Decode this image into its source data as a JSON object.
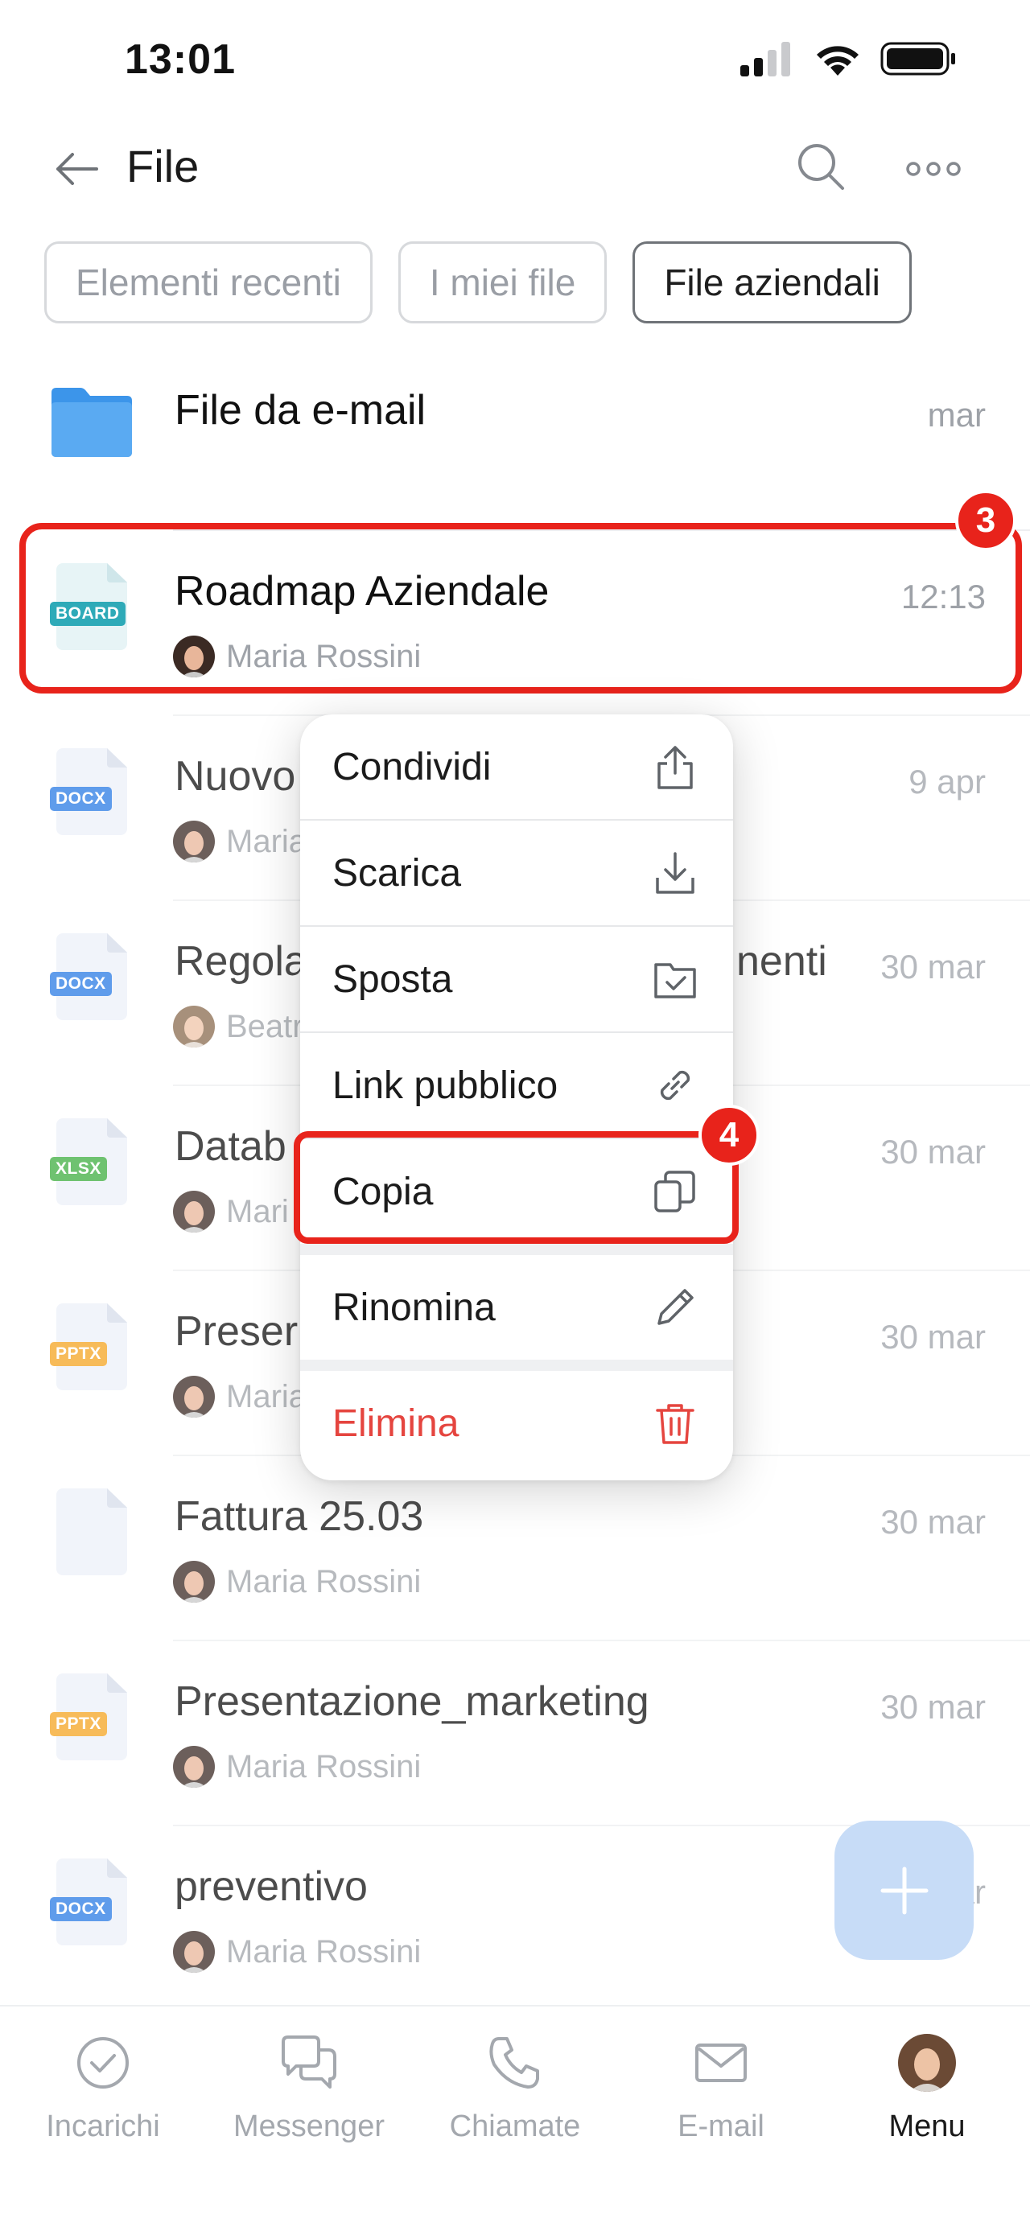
{
  "status_bar": {
    "time": "13:01"
  },
  "header": {
    "title": "File"
  },
  "tabs": [
    {
      "label": "Elementi recenti",
      "active": false
    },
    {
      "label": "I miei file",
      "active": false
    },
    {
      "label": "File aziendali",
      "active": true
    }
  ],
  "files": [
    {
      "name": "File da e-mail",
      "date": "mar",
      "type": "folder",
      "owner": ""
    },
    {
      "name": "Roadmap Aziendale",
      "date": "12:13",
      "type": "BOARD",
      "owner": "Maria Rossini"
    },
    {
      "name": "Nuovo",
      "date": "9 apr",
      "type": "DOCX",
      "owner": "Maria"
    },
    {
      "name": "Regola",
      "name_tail": "nenti",
      "date": "30 mar",
      "type": "DOCX",
      "owner": "Beatr"
    },
    {
      "name": "Datab",
      "date": "30 mar",
      "type": "XLSX",
      "owner": "Mari"
    },
    {
      "name": "Preser",
      "date": "30 mar",
      "type": "PPTX",
      "owner": "Maria"
    },
    {
      "name": "Fattura 25.03",
      "date": "30 mar",
      "type": "blank",
      "owner": "Maria Rossini"
    },
    {
      "name": "Presentazione_marketing",
      "date": "30 mar",
      "type": "PPTX",
      "owner": "Maria Rossini"
    },
    {
      "name": "preventivo",
      "date": "mar",
      "type": "DOCX",
      "owner": "Maria Rossini"
    }
  ],
  "context_menu": {
    "items": [
      {
        "label": "Condividi",
        "icon": "share-icon"
      },
      {
        "label": "Scarica",
        "icon": "download-icon"
      },
      {
        "label": "Sposta",
        "icon": "move-folder-icon"
      },
      {
        "label": "Link pubblico",
        "icon": "link-icon"
      },
      {
        "label": "Copia",
        "icon": "copy-icon"
      },
      {
        "label": "Rinomina",
        "icon": "pencil-icon"
      },
      {
        "label": "Elimina",
        "icon": "trash-icon"
      }
    ]
  },
  "annotations": {
    "step_row": "3",
    "step_copy": "4"
  },
  "bottom_nav": [
    {
      "label": "Incarichi",
      "icon": "check-circle-icon",
      "active": false
    },
    {
      "label": "Messenger",
      "icon": "chat-icon",
      "active": false
    },
    {
      "label": "Chiamate",
      "icon": "phone-icon",
      "active": false
    },
    {
      "label": "E-mail",
      "icon": "mail-icon",
      "active": false
    },
    {
      "label": "Menu",
      "icon": "avatar",
      "active": true
    }
  ],
  "colors": {
    "accent_red": "#e8231b",
    "danger": "#e5453f",
    "fab": "#c7dcf7"
  }
}
